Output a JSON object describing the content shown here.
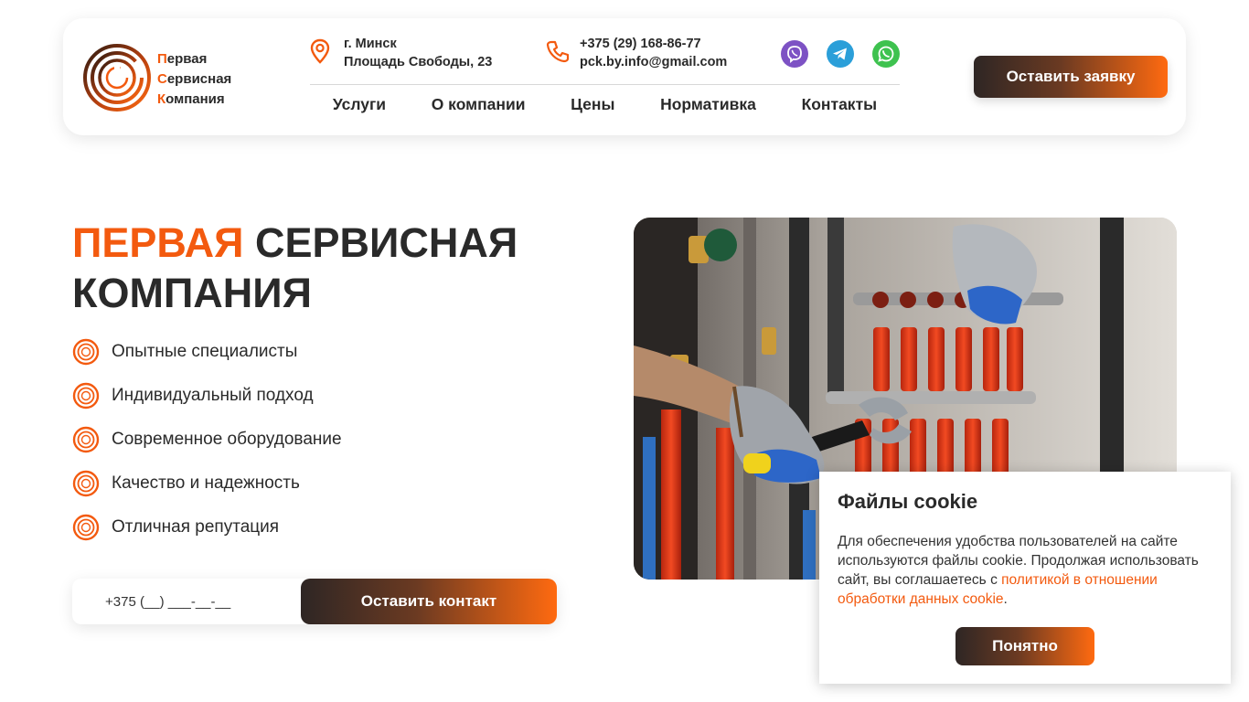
{
  "header": {
    "logo": {
      "line1_first": "П",
      "line1_rest": "ервая",
      "line2_first": "С",
      "line2_rest": "ервисная",
      "line3_first": "К",
      "line3_rest": "омпания"
    },
    "address": {
      "city": "г. Минск",
      "street": "Площадь Свободы, 23",
      "icon": "location-pin-icon"
    },
    "contacts": {
      "phone": "+375 (29) 168-86-77",
      "email": "pck.by.info@gmail.com",
      "icon": "phone-icon"
    },
    "socials": [
      {
        "name": "viber-icon",
        "color": "#7d52c4"
      },
      {
        "name": "telegram-icon",
        "color": "#2b9fd9"
      },
      {
        "name": "whatsapp-icon",
        "color": "#3ec24f"
      }
    ],
    "nav": [
      "Услуги",
      "О компании",
      "Цены",
      "Нормативка",
      "Контакты"
    ],
    "cta_label": "Оставить заявку"
  },
  "hero": {
    "title_accent": "ПЕРВАЯ",
    "title_rest1": " СЕРВИСНАЯ",
    "title_rest2": "КОМПАНИЯ",
    "features": [
      "Опытные специалисты",
      "Индивидуальный подход",
      "Современное оборудование",
      "Качество и надежность",
      "Отличная репутация"
    ],
    "phone_placeholder": "+375 (__) ___-__-__",
    "submit_label": "Оставить контакт"
  },
  "cookie": {
    "title": "Файлы cookie",
    "text": "Для обеспечения удобства пользователей на сайте используются файлы cookie. Продолжая использовать сайт, вы соглашаетесь с ",
    "link": "политикой в отношении обработки данных cookie",
    "text_end": ".",
    "button": "Понятно"
  },
  "colors": {
    "accent": "#f35a0f",
    "dark": "#2a2a2a"
  }
}
